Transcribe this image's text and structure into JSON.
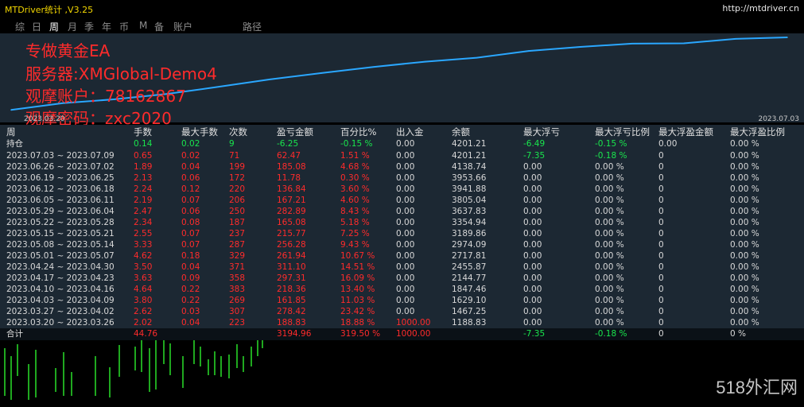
{
  "app": {
    "title": "MTDriver统计 ,V3.25",
    "url": "http://mtdriver.cn"
  },
  "tabs": [
    "综",
    "日",
    "周",
    "月",
    "季",
    "年",
    "币",
    "M",
    "备",
    "账户",
    "路径"
  ],
  "active_tab": "周",
  "overlay_lines": [
    "专做黄金EA",
    "服务器:XMGlobal-Demo4",
    "观摩账户：78162867",
    "观摩密码：zxc2020"
  ],
  "chart_dates": {
    "left": "2023.03.20",
    "right": "2023.07.03"
  },
  "chart_data": {
    "type": "line",
    "x": [
      "2023.03.20",
      "2023.03.27",
      "2023.04.03",
      "2023.04.10",
      "2023.04.17",
      "2023.04.24",
      "2023.05.01",
      "2023.05.08",
      "2023.05.15",
      "2023.05.22",
      "2023.05.29",
      "2023.06.05",
      "2023.06.12",
      "2023.06.19",
      "2023.06.26",
      "2023.07.03"
    ],
    "y": [
      1188.83,
      1467.25,
      1629.1,
      1847.46,
      2144.77,
      2455.87,
      2717.81,
      2974.09,
      3189.86,
      3354.94,
      3637.83,
      3805.04,
      3941.88,
      3953.66,
      4138.74,
      4201.21
    ]
  },
  "columns": [
    "周",
    "手数",
    "最大手数",
    "次数",
    "盈亏金额",
    "百分比%",
    "出入金",
    "余额",
    "最大浮亏",
    "最大浮亏比例",
    "最大浮盈金额",
    "最大浮盈比例"
  ],
  "holding": {
    "label": "持仓",
    "lots": "0.14",
    "max_lots": "0.02",
    "count": "9",
    "profit": "-6.25",
    "pct": "-0.15 %",
    "inout": "0.00",
    "balance": "4201.21",
    "max_float_loss": "-6.49",
    "max_float_loss_pct": "-0.15 %",
    "max_float_profit": "0.00",
    "max_float_profit_pct": "0.00 %"
  },
  "rows": [
    {
      "week": "2023.07.03 ~ 2023.07.09",
      "lots": "0.65",
      "max_lots": "0.02",
      "count": "71",
      "profit": "62.47",
      "pct": "1.51 %",
      "inout": "0.00",
      "balance": "4201.21",
      "mfl": "-7.35",
      "mflp": "-0.18 %",
      "mfp": "0",
      "mfpp": "0.00 %"
    },
    {
      "week": "2023.06.26 ~ 2023.07.02",
      "lots": "1.89",
      "max_lots": "0.04",
      "count": "199",
      "profit": "185.08",
      "pct": "4.68 %",
      "inout": "0.00",
      "balance": "4138.74",
      "mfl": "0.00",
      "mflp": "0.00 %",
      "mfp": "0",
      "mfpp": "0.00 %"
    },
    {
      "week": "2023.06.19 ~ 2023.06.25",
      "lots": "2.13",
      "max_lots": "0.06",
      "count": "172",
      "profit": "11.78",
      "pct": "0.30 %",
      "inout": "0.00",
      "balance": "3953.66",
      "mfl": "0.00",
      "mflp": "0.00 %",
      "mfp": "0",
      "mfpp": "0.00 %"
    },
    {
      "week": "2023.06.12 ~ 2023.06.18",
      "lots": "2.24",
      "max_lots": "0.12",
      "count": "220",
      "profit": "136.84",
      "pct": "3.60 %",
      "inout": "0.00",
      "balance": "3941.88",
      "mfl": "0.00",
      "mflp": "0.00 %",
      "mfp": "0",
      "mfpp": "0.00 %"
    },
    {
      "week": "2023.06.05 ~ 2023.06.11",
      "lots": "2.19",
      "max_lots": "0.07",
      "count": "206",
      "profit": "167.21",
      "pct": "4.60 %",
      "inout": "0.00",
      "balance": "3805.04",
      "mfl": "0.00",
      "mflp": "0.00 %",
      "mfp": "0",
      "mfpp": "0.00 %"
    },
    {
      "week": "2023.05.29 ~ 2023.06.04",
      "lots": "2.47",
      "max_lots": "0.06",
      "count": "250",
      "profit": "282.89",
      "pct": "8.43 %",
      "inout": "0.00",
      "balance": "3637.83",
      "mfl": "0.00",
      "mflp": "0.00 %",
      "mfp": "0",
      "mfpp": "0.00 %"
    },
    {
      "week": "2023.05.22 ~ 2023.05.28",
      "lots": "2.34",
      "max_lots": "0.08",
      "count": "187",
      "profit": "165.08",
      "pct": "5.18 %",
      "inout": "0.00",
      "balance": "3354.94",
      "mfl": "0.00",
      "mflp": "0.00 %",
      "mfp": "0",
      "mfpp": "0.00 %"
    },
    {
      "week": "2023.05.15 ~ 2023.05.21",
      "lots": "2.55",
      "max_lots": "0.07",
      "count": "237",
      "profit": "215.77",
      "pct": "7.25 %",
      "inout": "0.00",
      "balance": "3189.86",
      "mfl": "0.00",
      "mflp": "0.00 %",
      "mfp": "0",
      "mfpp": "0.00 %"
    },
    {
      "week": "2023.05.08 ~ 2023.05.14",
      "lots": "3.33",
      "max_lots": "0.07",
      "count": "287",
      "profit": "256.28",
      "pct": "9.43 %",
      "inout": "0.00",
      "balance": "2974.09",
      "mfl": "0.00",
      "mflp": "0.00 %",
      "mfp": "0",
      "mfpp": "0.00 %"
    },
    {
      "week": "2023.05.01 ~ 2023.05.07",
      "lots": "4.62",
      "max_lots": "0.18",
      "count": "329",
      "profit": "261.94",
      "pct": "10.67 %",
      "inout": "0.00",
      "balance": "2717.81",
      "mfl": "0.00",
      "mflp": "0.00 %",
      "mfp": "0",
      "mfpp": "0.00 %"
    },
    {
      "week": "2023.04.24 ~ 2023.04.30",
      "lots": "3.50",
      "max_lots": "0.04",
      "count": "371",
      "profit": "311.10",
      "pct": "14.51 %",
      "inout": "0.00",
      "balance": "2455.87",
      "mfl": "0.00",
      "mflp": "0.00 %",
      "mfp": "0",
      "mfpp": "0.00 %"
    },
    {
      "week": "2023.04.17 ~ 2023.04.23",
      "lots": "3.63",
      "max_lots": "0.09",
      "count": "358",
      "profit": "297.31",
      "pct": "16.09 %",
      "inout": "0.00",
      "balance": "2144.77",
      "mfl": "0.00",
      "mflp": "0.00 %",
      "mfp": "0",
      "mfpp": "0.00 %"
    },
    {
      "week": "2023.04.10 ~ 2023.04.16",
      "lots": "4.64",
      "max_lots": "0.22",
      "count": "383",
      "profit": "218.36",
      "pct": "13.40 %",
      "inout": "0.00",
      "balance": "1847.46",
      "mfl": "0.00",
      "mflp": "0.00 %",
      "mfp": "0",
      "mfpp": "0.00 %"
    },
    {
      "week": "2023.04.03 ~ 2023.04.09",
      "lots": "3.80",
      "max_lots": "0.22",
      "count": "269",
      "profit": "161.85",
      "pct": "11.03 %",
      "inout": "0.00",
      "balance": "1629.10",
      "mfl": "0.00",
      "mflp": "0.00 %",
      "mfp": "0",
      "mfpp": "0.00 %"
    },
    {
      "week": "2023.03.27 ~ 2023.04.02",
      "lots": "2.62",
      "max_lots": "0.03",
      "count": "307",
      "profit": "278.42",
      "pct": "23.42 %",
      "inout": "0.00",
      "balance": "1467.25",
      "mfl": "0.00",
      "mflp": "0.00 %",
      "mfp": "0",
      "mfpp": "0.00 %"
    },
    {
      "week": "2023.03.20 ~ 2023.03.26",
      "lots": "2.02",
      "max_lots": "0.04",
      "count": "223",
      "profit": "188.83",
      "pct": "18.88 %",
      "inout": "1000.00",
      "balance": "1188.83",
      "mfl": "0.00",
      "mflp": "0.00 %",
      "mfp": "0",
      "mfpp": "0.00 %"
    }
  ],
  "total": {
    "label": "合计",
    "lots": "44.76",
    "profit": "3194.96",
    "pct": "319.50 %",
    "inout": "1000.00",
    "mfl": "-7.35",
    "mflp": "-0.18 %",
    "mfp": "0",
    "mfpp": "0 %"
  },
  "watermark": "518外汇网",
  "colors": {
    "title": "#f2d600",
    "red": "#ff2b2b",
    "green": "#19e64d",
    "line": "#2aa7ff",
    "panel": "#1c2833",
    "candle": "#1fa81f"
  }
}
